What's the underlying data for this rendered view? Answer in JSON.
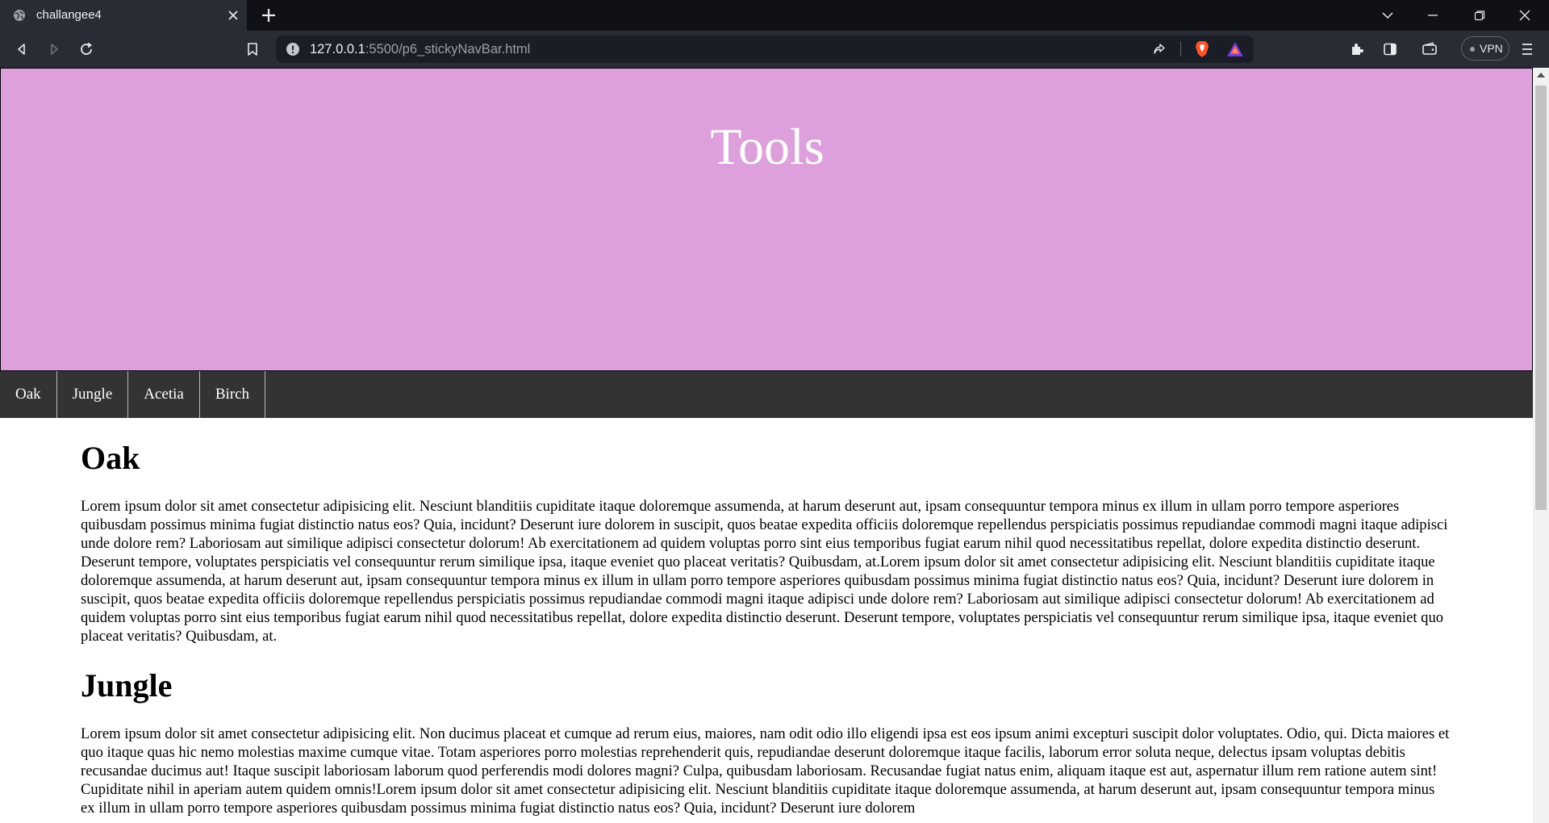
{
  "browser": {
    "tab_title": "challangee4",
    "url_host": "127.0.0.1",
    "url_rest": ":5500/p6_stickyNavBar.html",
    "vpn_label": "VPN",
    "icons": [
      "globe-icon",
      "close-icon",
      "plus-icon",
      "chevron-down-icon",
      "minimize-icon",
      "restore-icon",
      "window-close-icon",
      "back-icon",
      "forward-icon",
      "reload-icon",
      "bookmark-icon",
      "info-icon",
      "share-icon",
      "brave-shield-icon",
      "brave-rewards-icon",
      "extensions-icon",
      "sidebar-icon",
      "wallet-icon",
      "menu-icon"
    ]
  },
  "page": {
    "hero_title": "Tools",
    "nav": [
      "Oak",
      "Jungle",
      "Acetia",
      "Birch"
    ],
    "sections": [
      {
        "heading": "Oak",
        "text": "Lorem ipsum dolor sit amet consectetur adipisicing elit. Nesciunt blanditiis cupiditate itaque doloremque assumenda, at harum deserunt aut, ipsam consequuntur tempora minus ex illum in ullam porro tempore asperiores quibusdam possimus minima fugiat distinctio natus eos? Quia, incidunt? Deserunt iure dolorem in suscipit, quos beatae expedita officiis doloremque repellendus perspiciatis possimus repudiandae commodi magni itaque adipisci unde dolore rem? Laboriosam aut similique adipisci consectetur dolorum! Ab exercitationem ad quidem voluptas porro sint eius temporibus fugiat earum nihil quod necessitatibus repellat, dolore expedita distinctio deserunt. Deserunt tempore, voluptates perspiciatis vel consequuntur rerum similique ipsa, itaque eveniet quo placeat veritatis? Quibusdam, at.Lorem ipsum dolor sit amet consectetur adipisicing elit. Nesciunt blanditiis cupiditate itaque doloremque assumenda, at harum deserunt aut, ipsam consequuntur tempora minus ex illum in ullam porro tempore asperiores quibusdam possimus minima fugiat distinctio natus eos? Quia, incidunt? Deserunt iure dolorem in suscipit, quos beatae expedita officiis doloremque repellendus perspiciatis possimus repudiandae commodi magni itaque adipisci unde dolore rem? Laboriosam aut similique adipisci consectetur dolorum! Ab exercitationem ad quidem voluptas porro sint eius temporibus fugiat earum nihil quod necessitatibus repellat, dolore expedita distinctio deserunt. Deserunt tempore, voluptates perspiciatis vel consequuntur rerum similique ipsa, itaque eveniet quo placeat veritatis? Quibusdam, at."
      },
      {
        "heading": "Jungle",
        "text": "Lorem ipsum dolor sit amet consectetur adipisicing elit. Non ducimus placeat et cumque ad rerum eius, maiores, nam odit odio illo eligendi ipsa est eos ipsum animi excepturi suscipit dolor voluptates. Odio, qui. Dicta maiores et quo itaque quas hic nemo molestias maxime cumque vitae. Totam asperiores porro molestias reprehenderit quis, repudiandae deserunt doloremque itaque facilis, laborum error soluta neque, delectus ipsam voluptas debitis recusandae ducimus aut! Itaque suscipit laboriosam laborum quod perferendis modi dolores magni? Culpa, quibusdam laboriosam. Recusandae fugiat natus enim, aliquam itaque est aut, aspernatur illum rem ratione autem sint! Cupiditate nihil in aperiam autem quidem omnis!Lorem ipsum dolor sit amet consectetur adipisicing elit. Nesciunt blanditiis cupiditate itaque doloremque assumenda, at harum deserunt aut, ipsam consequuntur tempora minus ex illum in ullam porro tempore asperiores quibusdam possimus minima fugiat distinctio natus eos? Quia, incidunt? Deserunt iure dolorem"
      }
    ]
  }
}
